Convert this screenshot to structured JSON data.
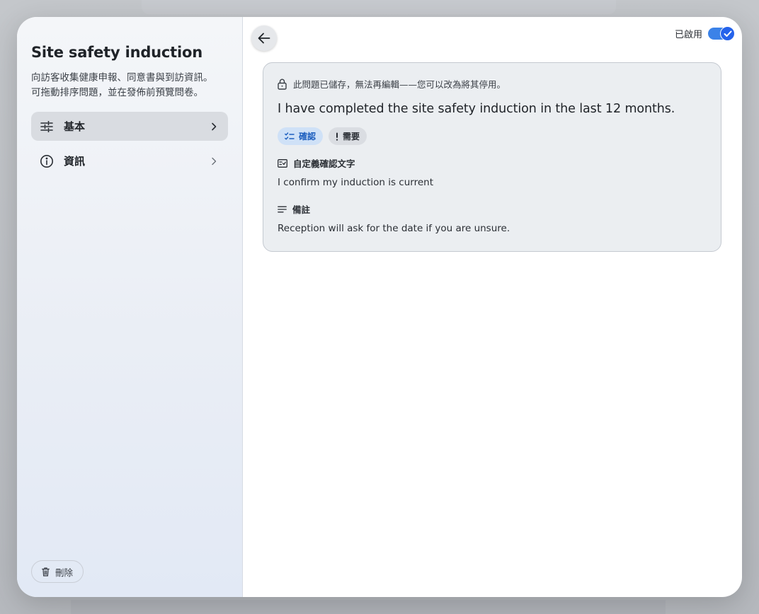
{
  "sidebar": {
    "title": "Site safety induction",
    "description": "向訪客收集健康申報、同意書與到訪資訊。\n可拖動排序問題，並在發佈前預覽問卷。",
    "items": [
      {
        "label": "基本",
        "icon": "sliders-icon",
        "active": true
      },
      {
        "label": "資訊",
        "icon": "info-icon",
        "active": false
      }
    ],
    "delete_label": "刪除"
  },
  "header": {
    "toggle_label": "已啟用",
    "toggle_on": true,
    "accent": "#3b82e8"
  },
  "question_card": {
    "lock_notice": "此問題已儲存，無法再編輯——您可以改為將其停用。",
    "question_text": "I have completed the site safety induction in the last 12 months.",
    "chips": {
      "type_label": "確認",
      "required_label": "需要"
    },
    "confirm_text": {
      "heading": "自定義確認文字",
      "value": "I confirm my induction is current"
    },
    "notes": {
      "heading": "備註",
      "value": "Reception will ask for the date if you are unsure."
    }
  }
}
